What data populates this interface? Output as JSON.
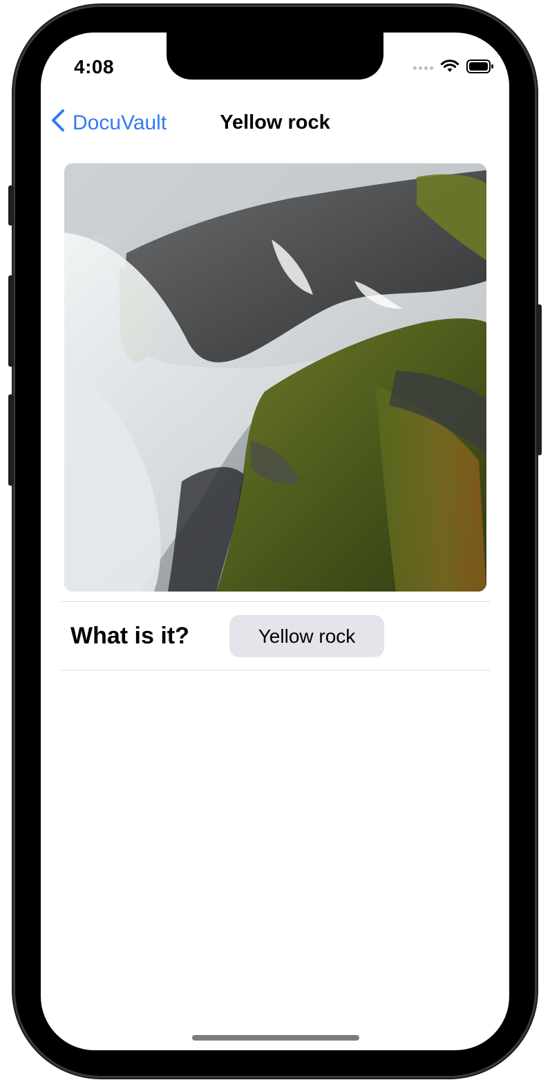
{
  "status_bar": {
    "time": "4:08"
  },
  "nav": {
    "back_label": "DocuVault",
    "title": "Yellow rock"
  },
  "detail": {
    "question_label": "What is it?",
    "answer_value": "Yellow rock"
  },
  "colors": {
    "accent": "#3478f6",
    "chip_background": "#e4e4ea"
  },
  "icons": {
    "back": "chevron-left-icon",
    "wifi": "wifi-icon",
    "battery": "battery-icon",
    "signal": "cellular-signal-icon"
  }
}
